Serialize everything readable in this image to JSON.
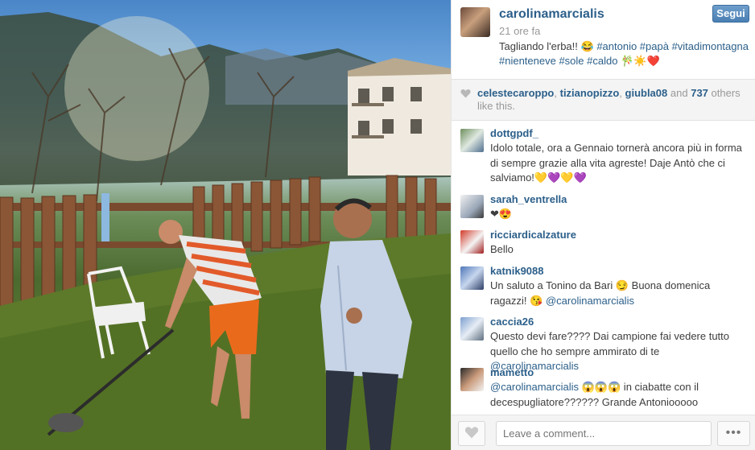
{
  "post": {
    "owner": "carolinamarcialis",
    "time_ago": "21 ore fa",
    "follow_label": "Segui",
    "caption_text": "Tagliando l'erba!! 😂",
    "caption_hashtags": "#antonio #papà #vitadimontagna #nienteneve #sole #caldo",
    "caption_emoji": "🎋☀️❤️"
  },
  "likes": {
    "user1": "celestecaroppo",
    "user2": "tizianopizzo",
    "user3": "giubla08",
    "and_label": "and",
    "count": "737",
    "others_label": "others like this."
  },
  "comments": [
    {
      "user": "dottgpdf_",
      "text": "Idolo totale, ora a Gennaio tornerà ancora più in forma di sempre grazie alla vita agreste! Daje Antò che ci salviamo!💛💜💛💜",
      "mention": ""
    },
    {
      "user": "sarah_ventrella",
      "text": "❤😍",
      "mention": ""
    },
    {
      "user": "ricciardicalzature",
      "text": "Bello",
      "mention": ""
    },
    {
      "user": "katnik9088",
      "text": "Un saluto a Tonino da Bari 😏 Buona domenica ragazzi! 😘",
      "mention": "@carolinamarcialis"
    },
    {
      "user": "caccia26",
      "text": "Questo devi fare???? Dai campione fai vedere tutto quello che ho sempre ammirato di te",
      "mention": "@carolinamarcialis"
    },
    {
      "user": "mametto",
      "text": "😱😱😱 in ciabatte con il decespugliatore?????? Grande Antoniooooo",
      "mention": "@carolinamarcialis"
    }
  ],
  "footer": {
    "comment_placeholder": "Leave a comment...",
    "more_label": "•••"
  },
  "colors": {
    "link": "#2b5f8a",
    "follow_button": "#4a7fb3",
    "muted": "#999999"
  },
  "icons": {
    "likes_heart": "heart-icon",
    "like_button": "heart-icon",
    "more_button": "more-dots-icon"
  }
}
